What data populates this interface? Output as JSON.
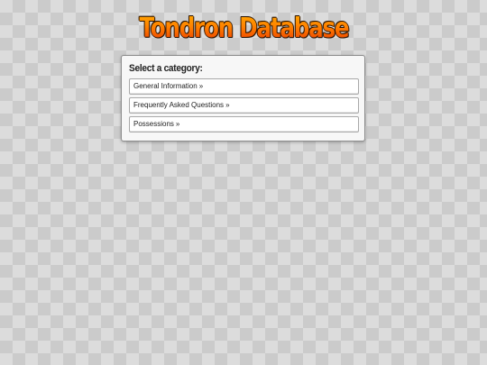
{
  "header": {
    "title": "Tondron Database"
  },
  "panel": {
    "heading": "Select a category:",
    "categories": [
      {
        "label": "General Information",
        "arrow": "»"
      },
      {
        "label": "Frequently Asked Questions",
        "arrow": "»"
      },
      {
        "label": "Possessions",
        "arrow": "»"
      }
    ]
  },
  "colors": {
    "title_top": "#ffb000",
    "title_bottom": "#e52800",
    "title_outline": "#2a1200",
    "panel_bg": "#f7f7f7",
    "checker_light": "#dcdcdc",
    "checker_dark": "#cbcbcb"
  }
}
